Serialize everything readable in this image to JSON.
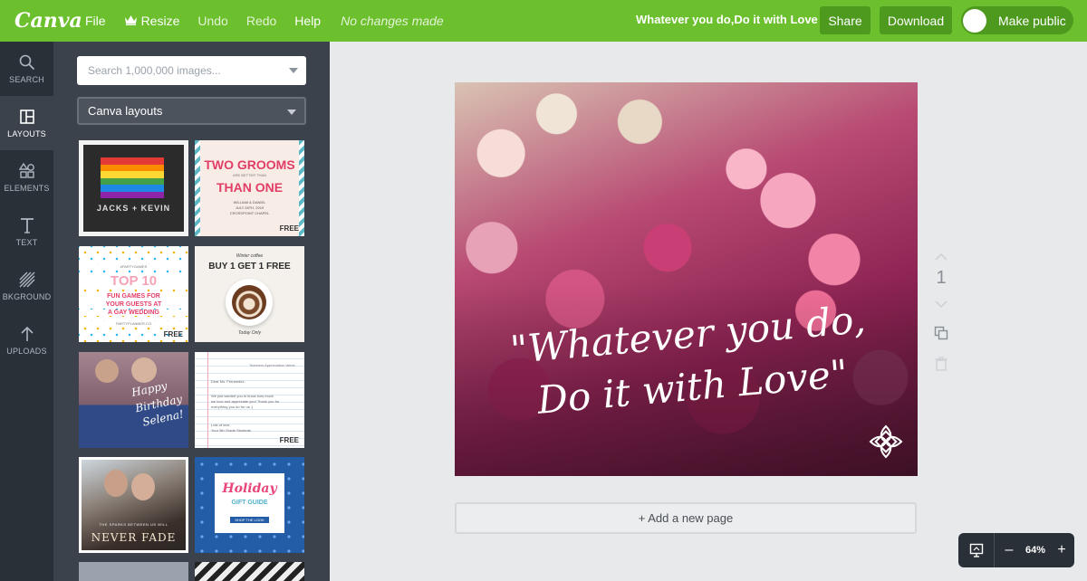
{
  "topbar": {
    "logo": "Canva",
    "menu": {
      "file": "File",
      "resize": "Resize",
      "undo": "Undo",
      "redo": "Redo",
      "help": "Help"
    },
    "status": "No changes made",
    "document_title": "Whatever you do,Do it with Love",
    "share_label": "Share",
    "download_label": "Download",
    "make_public_label": "Make public",
    "colors": {
      "bar": "#6cbf2d",
      "button": "#4e9a1f"
    }
  },
  "iconbar": {
    "items": [
      {
        "label": "SEARCH",
        "icon": "search-icon"
      },
      {
        "label": "LAYOUTS",
        "icon": "layouts-icon",
        "active": true
      },
      {
        "label": "ELEMENTS",
        "icon": "elements-icon"
      },
      {
        "label": "TEXT",
        "icon": "text-icon"
      },
      {
        "label": "BKGROUND",
        "icon": "background-icon"
      },
      {
        "label": "UPLOADS",
        "icon": "upload-icon"
      }
    ]
  },
  "panel": {
    "search_placeholder": "Search 1,000,000 images...",
    "layout_select": "Canva layouts",
    "thumbnails": {
      "t1": {
        "line1": "JACKS + KEVIN"
      },
      "t2": {
        "line1": "TWO GROOMS",
        "line2": "ARE BETTER THAN",
        "line3": "THAN ONE",
        "line4": "WILLIAM & DANIEL",
        "line5": "JULY 28TH, 2019",
        "line6": "CROSSPOINT CHAPEL",
        "badge": "FREE"
      },
      "t3": {
        "line1": "#PARTYGAMES",
        "line2": "TOP 10",
        "line3": "FUN GAMES FOR",
        "line4": "YOUR GUESTS AT",
        "line5": "A GAY WEDDING",
        "line6": "PARTYPLANNER.CO",
        "badge": "FREE"
      },
      "t4": {
        "line1": "Winter coffee",
        "line2": "BUY 1 GET 1 FREE",
        "line3": "Today Only"
      },
      "t5": {
        "line1": "Happy",
        "line2": "Birthday",
        "line3": "Selena!"
      },
      "t6": {
        "line1": "Teachers Appreciation Week",
        "line2": "Dear Ms. Fernandez,",
        "line3": "We just wanted you to know how much",
        "line4": "we love and appreciate you! Thank you for",
        "line5": "everything you do for us :)",
        "line6": "Lots of love,",
        "line7": "Your 5th Grade Students",
        "badge": "FREE"
      },
      "t7": {
        "line1": "THE SPARKS BETWEEN US WILL",
        "line2": "NEVER FADE"
      },
      "t8": {
        "line1": "Holiday",
        "line2": "GIFT GUIDE",
        "line3": "SHOP THE LOOK"
      }
    }
  },
  "canvas": {
    "quote_line1": "\"Whatever you do,",
    "quote_line2": "Do it with Love\"",
    "add_page_label": "+ Add a new page",
    "page_number": "1"
  },
  "zoom": {
    "minus": "–",
    "value": "64%",
    "plus": "+"
  }
}
